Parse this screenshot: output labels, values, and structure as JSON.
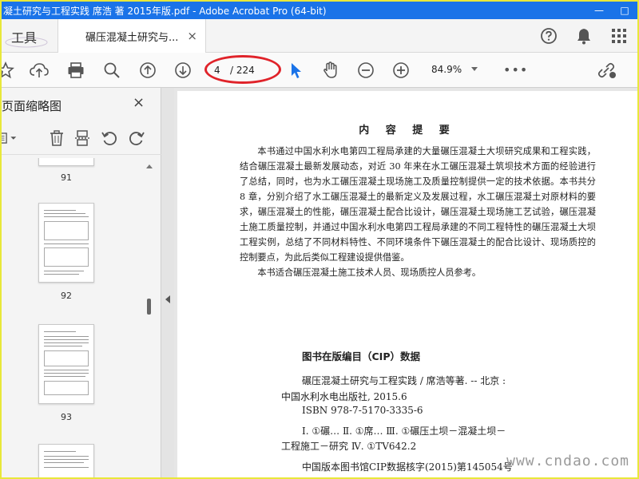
{
  "window": {
    "title": "凝土研究与工程实践 席浩 著 2015年版.pdf - Adobe Acrobat Pro (64-bit)"
  },
  "tabs": {
    "tools_label": "工具",
    "document_label": "碾压混凝土研究与...",
    "close_glyph": "×"
  },
  "toolbar": {
    "current_page": "4",
    "total_pages": "/ 224",
    "zoom": "84.9%"
  },
  "left_panel": {
    "title": "页面缩略图",
    "close_glyph": "×",
    "thumbnails": [
      {
        "label": "91"
      },
      {
        "label": "92"
      },
      {
        "label": "93"
      }
    ]
  },
  "document": {
    "abstract_title": "内 容 提 要",
    "abstract_para1": "本书通过中国水利水电第四工程局承建的大量碾压混凝土大坝研究成果和工程实践，结合碾压混凝土最新发展动态，对近 30 年来在水工碾压混凝土筑坝技术方面的经验进行了总结，同时，也为水工碾压混凝土现场施工及质量控制提供一定的技术依据。本书共分 8 章，分别介绍了水工碾压混凝土的最新定义及发展过程，水工碾压混凝土对原材料的要求，碾压混凝土的性能，碾压混凝土配合比设计，碾压混凝土现场施工艺试验，碾压混凝土施工质量控制，并通过中国水利水电第四工程局承建的不同工程特性的碾压混凝土大坝工程实例，总结了不同材料特性、不同环境条件下碾压混凝土的配合比设计、现场质控的控制要点，为此后类似工程建设提供借鉴。",
    "abstract_para2": "本书适合碾压混凝土施工技术人员、现场质控人员参考。",
    "cip_title": "图书在版编目（CIP）数据",
    "cip_lines": [
      "碾压混凝土研究与工程实践 / 席浩等著. -- 北京 :",
      "中国水利水电出版社, 2015.6",
      "ISBN 978-7-5170-3335-6",
      "Ⅰ. ①碾…  Ⅱ. ①席…  Ⅲ. ①碾压土坝－混凝土坝－",
      "工程施工－研究  Ⅳ. ①TV642.2",
      "中国版本图书馆CIP数据核字(2015)第145054号"
    ],
    "watermark": "www.cndao.com"
  },
  "colors": {
    "titlebar": "#1a73e8",
    "highlight_ellipse": "#e0232a",
    "outer_border": "#e8e83a",
    "cursor_blue": "#1a73e8"
  }
}
